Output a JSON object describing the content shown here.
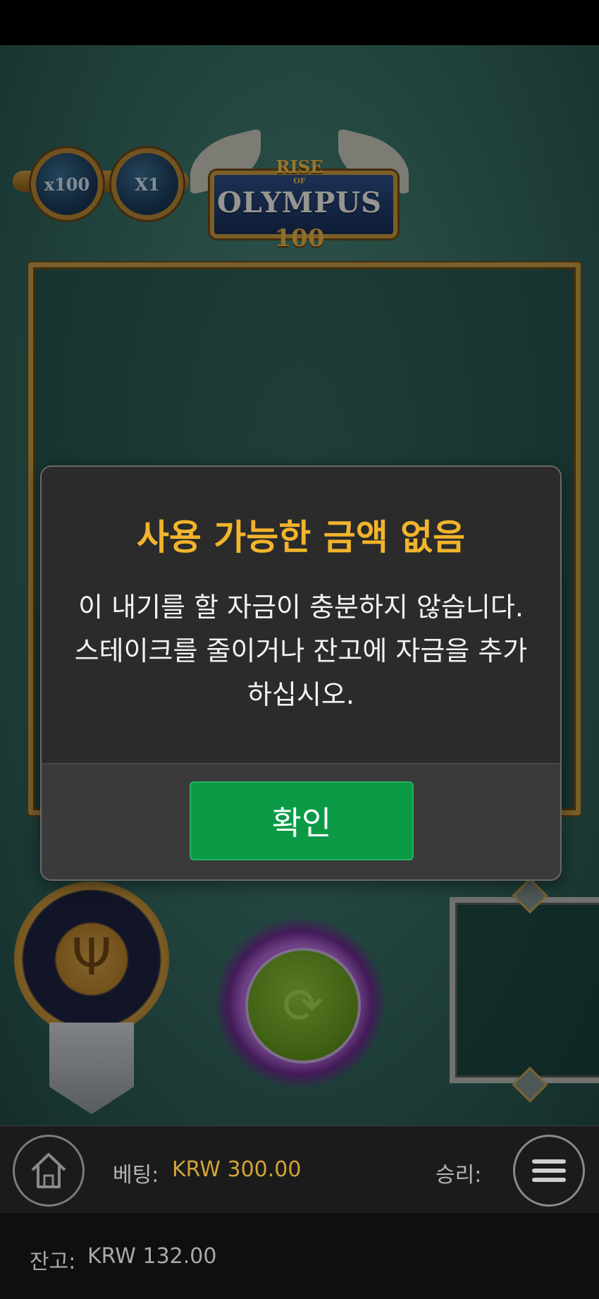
{
  "game": {
    "logo_rise": "RISE",
    "logo_of": "OF",
    "logo_olympus": "OLYMPUS",
    "logo_hundred": "100",
    "multipliers": [
      "x100",
      "X1"
    ]
  },
  "modal": {
    "title": "사용 가능한 금액 없음",
    "message": "이 내기를 할 자금이 충분하지 않습니다. 스테이크를 줄이거나 잔고에 자금을 추가하십시오.",
    "confirm_label": "확인"
  },
  "bottom_bar": {
    "bet_label": "베팅:",
    "bet_value": "KRW 300.00",
    "win_label": "승리:",
    "balance_label": "잔고:",
    "balance_value": "KRW 132.00"
  },
  "icons": {
    "home": "home-icon",
    "menu": "hamburger-menu-icon",
    "spin": "spin-arrows-icon",
    "shield": "trident-shield-icon"
  },
  "colors": {
    "accent_gold": "#f2b42c",
    "confirm_green": "#0a9a46",
    "bet_gold": "#d2a437"
  }
}
